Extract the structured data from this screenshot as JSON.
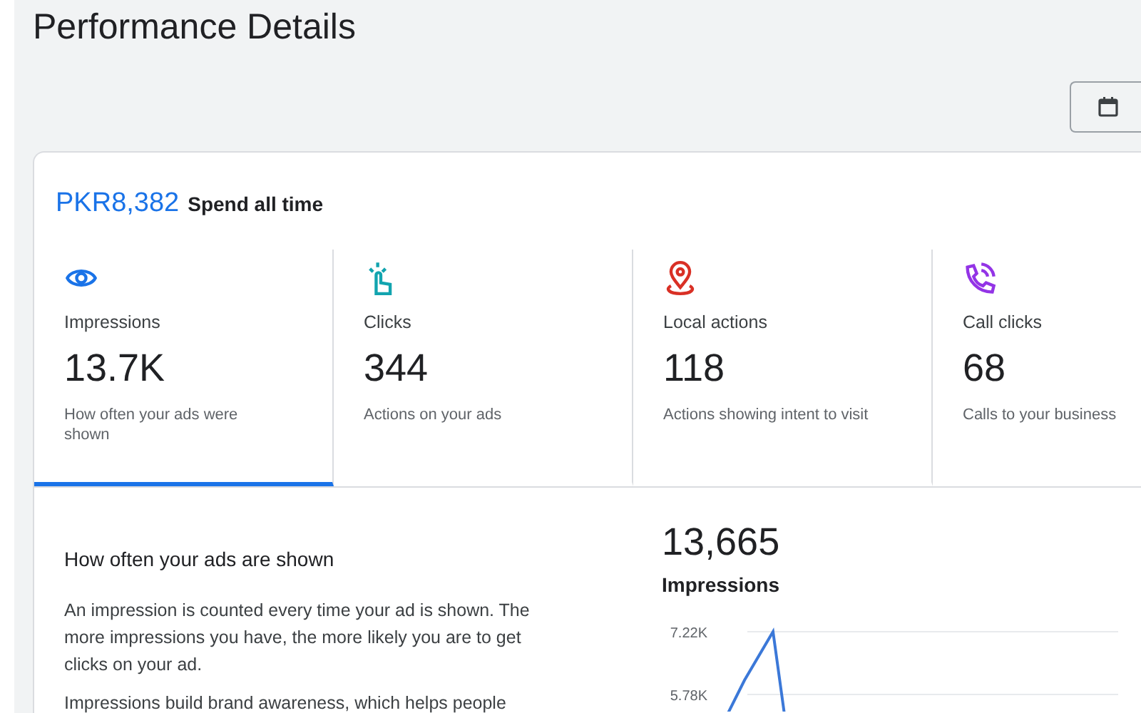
{
  "page": {
    "title": "Performance Details"
  },
  "spend": {
    "amount": "PKR8,382",
    "label": "Spend all time"
  },
  "metrics": [
    {
      "kind": "eye",
      "label": "Impressions",
      "value": "13.7K",
      "description": "How often your ads were shown",
      "selected": true
    },
    {
      "kind": "tap",
      "label": "Clicks",
      "value": "344",
      "description": "Actions on your ads",
      "selected": false
    },
    {
      "kind": "pin",
      "label": "Local actions",
      "value": "118",
      "description": "Actions showing intent to visit",
      "selected": false
    },
    {
      "kind": "phone",
      "label": "Call clicks",
      "value": "68",
      "description": "Calls to your business",
      "selected": false
    }
  ],
  "detail": {
    "heading": "How often your ads are shown",
    "paragraphs": [
      "An impression is counted every time your ad is shown. The more impressions you have, the more likely you are to get clicks on your ad.",
      "Impressions build brand awareness, which helps people"
    ],
    "total": "13,665",
    "total_label": "Impressions",
    "axis_labels": [
      "7.22K",
      "5.78K"
    ]
  }
}
